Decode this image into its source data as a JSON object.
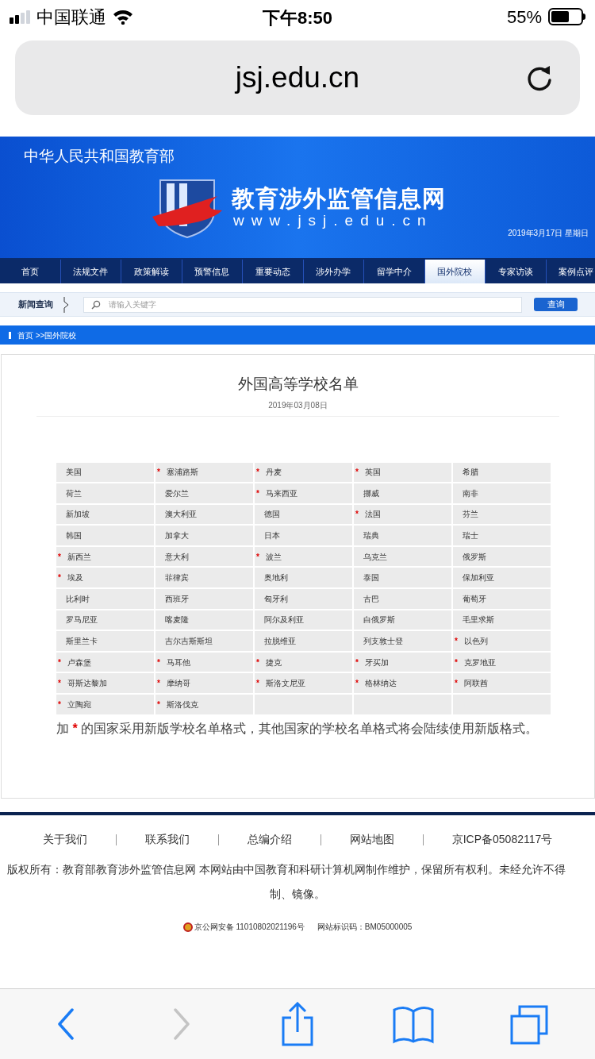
{
  "status_bar": {
    "carrier": "中国联通",
    "time": "下午8:50",
    "battery": "55%"
  },
  "url_bar": {
    "url": "jsj.edu.cn"
  },
  "banner": {
    "ministry": "中华人民共和国教育部",
    "site_name": "教育涉外监管信息网",
    "site_url": "www.jsj.edu.cn",
    "date": "2019年3月17日 星期日"
  },
  "nav": [
    {
      "label": "首页",
      "selected": false
    },
    {
      "label": "法规文件",
      "selected": false
    },
    {
      "label": "政策解读",
      "selected": false
    },
    {
      "label": "预警信息",
      "selected": false
    },
    {
      "label": "重要动态",
      "selected": false
    },
    {
      "label": "涉外办学",
      "selected": false
    },
    {
      "label": "留学中介",
      "selected": false
    },
    {
      "label": "国外院校",
      "selected": true
    },
    {
      "label": "专家访谈",
      "selected": false
    },
    {
      "label": "案例点评",
      "selected": false
    }
  ],
  "search": {
    "label": "新闻查询",
    "placeholder": "请输入关键字",
    "button": "查询"
  },
  "breadcrumb": "首页 >>国外院校",
  "article": {
    "title": "外国高等学校名单",
    "date": "2019年03月08日",
    "rows": [
      [
        {
          "name": "美国",
          "marked": false
        },
        {
          "name": "塞浦路斯",
          "marked": true
        },
        {
          "name": "丹麦",
          "marked": true
        },
        {
          "name": "英国",
          "marked": true
        },
        {
          "name": "希腊",
          "marked": false
        }
      ],
      [
        {
          "name": "荷兰",
          "marked": false
        },
        {
          "name": "爱尔兰",
          "marked": false
        },
        {
          "name": "马来西亚",
          "marked": true
        },
        {
          "name": "挪威",
          "marked": false
        },
        {
          "name": "南非",
          "marked": false
        }
      ],
      [
        {
          "name": "新加坡",
          "marked": false
        },
        {
          "name": "澳大利亚",
          "marked": false
        },
        {
          "name": "德国",
          "marked": false
        },
        {
          "name": "法国",
          "marked": true
        },
        {
          "name": "芬兰",
          "marked": false
        }
      ],
      [
        {
          "name": "韩国",
          "marked": false
        },
        {
          "name": "加拿大",
          "marked": false
        },
        {
          "name": "日本",
          "marked": false
        },
        {
          "name": "瑞典",
          "marked": false
        },
        {
          "name": "瑞士",
          "marked": false
        }
      ],
      [
        {
          "name": "新西兰",
          "marked": true
        },
        {
          "name": "意大利",
          "marked": false
        },
        {
          "name": "波兰",
          "marked": true
        },
        {
          "name": "乌克兰",
          "marked": false
        },
        {
          "name": "俄罗斯",
          "marked": false
        }
      ],
      [
        {
          "name": "埃及",
          "marked": true
        },
        {
          "name": "菲律宾",
          "marked": false
        },
        {
          "name": "奥地利",
          "marked": false
        },
        {
          "name": "泰国",
          "marked": false
        },
        {
          "name": "保加利亚",
          "marked": false
        }
      ],
      [
        {
          "name": "比利时",
          "marked": false
        },
        {
          "name": "西班牙",
          "marked": false
        },
        {
          "name": "匈牙利",
          "marked": false
        },
        {
          "name": "古巴",
          "marked": false
        },
        {
          "name": "葡萄牙",
          "marked": false
        }
      ],
      [
        {
          "name": "罗马尼亚",
          "marked": false
        },
        {
          "name": "喀麦隆",
          "marked": false
        },
        {
          "name": "阿尔及利亚",
          "marked": false
        },
        {
          "name": "白俄罗斯",
          "marked": false
        },
        {
          "name": "毛里求斯",
          "marked": false
        }
      ],
      [
        {
          "name": "斯里兰卡",
          "marked": false
        },
        {
          "name": "吉尔吉斯斯坦",
          "marked": false
        },
        {
          "name": "拉脱维亚",
          "marked": false
        },
        {
          "name": "列支敦士登",
          "marked": false
        },
        {
          "name": "以色列",
          "marked": true
        }
      ],
      [
        {
          "name": "卢森堡",
          "marked": true
        },
        {
          "name": "马耳他",
          "marked": true
        },
        {
          "name": "捷克",
          "marked": true
        },
        {
          "name": "牙买加",
          "marked": true
        },
        {
          "name": "克罗地亚",
          "marked": true
        }
      ],
      [
        {
          "name": "哥斯达黎加",
          "marked": true
        },
        {
          "name": "摩纳哥",
          "marked": true
        },
        {
          "name": "斯洛文尼亚",
          "marked": true
        },
        {
          "name": "格林纳达",
          "marked": true
        },
        {
          "name": "阿联酋",
          "marked": true
        }
      ],
      [
        {
          "name": "立陶宛",
          "marked": true
        },
        {
          "name": "斯洛伐克",
          "marked": true
        }
      ]
    ],
    "mark_symbol": "*",
    "note": {
      "before": "加",
      "mark": "*",
      "after": "的国家采用新版学校名单格式，其他国家的学校名单格式将会陆续使用新版格式。"
    }
  },
  "footer": {
    "links": [
      "关于我们",
      "联系我们",
      "总编介绍",
      "网站地图",
      "京ICP备05082117号"
    ],
    "copyright_lines": [
      "版权所有：教育部教育涉外监管信息网 本网站由中国教育和科研计算机网制作维护，保留所有权利。未经允许不得",
      "制、镜像。"
    ],
    "beian": "京公网安备 11010802021196号",
    "site_id": "网站标识码：BM05000005"
  }
}
